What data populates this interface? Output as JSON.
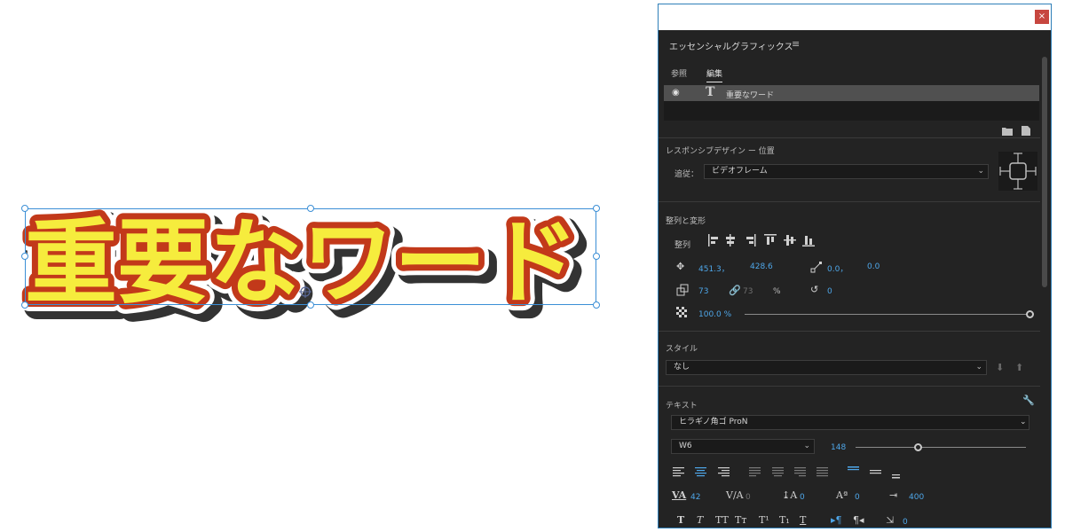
{
  "canvas": {
    "text": "重要なワード",
    "colors": {
      "fill": "#f6ec3d",
      "stroke": "#c2391a",
      "outer": "#ffffff",
      "shadow": "#333333",
      "selection": "#3b8fd6"
    }
  },
  "panel": {
    "close_label": "×",
    "title": "エッセンシャルグラフィックス",
    "menu_icon": "≡",
    "tabs": [
      {
        "label": "参照"
      },
      {
        "label": "編集"
      }
    ],
    "layer": {
      "eye_icon": "eye-icon",
      "eye_glyph": "◉",
      "type_glyph": "T",
      "name": "重要なワード"
    },
    "responsive": {
      "heading": "レスポンシブデザイン ー 位置",
      "follow_label": "追従：",
      "follow_value": "ビデオフレーム"
    },
    "align": {
      "heading": "整列と変形",
      "align_label": "整列",
      "position_x": "451.3，",
      "position_y": "428.6",
      "anchor_x": "0.0，",
      "anchor_y": "0.0",
      "scale_w": "73",
      "scale_h": "73",
      "scale_unit": "%",
      "rotation": "0",
      "opacity": "100.0 %",
      "opacity_fraction": 1.0
    },
    "style": {
      "heading": "スタイル",
      "value": "なし"
    },
    "text": {
      "heading": "テキスト",
      "font": "ヒラギノ角ゴ ProN",
      "weight": "W6",
      "size": "148",
      "size_fraction": 0.37,
      "tracking": "42",
      "kerning": "0",
      "leading": "0",
      "baseline": "0",
      "tab_width": "400",
      "indent": "0",
      "style_buttons": [
        "T",
        "T",
        "TT",
        "Tт",
        "T¹",
        "T₁",
        "T"
      ]
    }
  }
}
